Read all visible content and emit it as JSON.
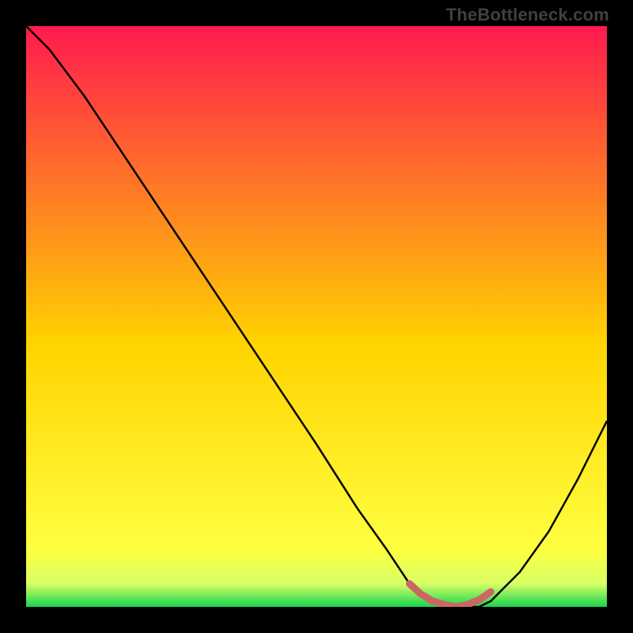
{
  "brand": "TheBottleneck.com",
  "colors": {
    "top": "#ff1a4e",
    "mid": "#ffd400",
    "low": "#ffff40",
    "bottom": "#17d64e",
    "curve": "#000000",
    "marker": "#cc6666"
  },
  "chart_data": {
    "type": "line",
    "title": "",
    "xlabel": "",
    "ylabel": "",
    "xlim": [
      0,
      100
    ],
    "ylim": [
      0,
      100
    ],
    "grid": false,
    "series": [
      {
        "name": "bottleneck-curve",
        "x": [
          0,
          4,
          10,
          20,
          30,
          40,
          50,
          57,
          62,
          66,
          70,
          74,
          78,
          80,
          85,
          90,
          95,
          100
        ],
        "y": [
          100,
          96,
          88,
          73,
          58,
          43,
          28,
          17,
          10,
          4,
          1,
          0,
          0,
          1,
          6,
          13,
          22,
          32
        ]
      }
    ],
    "highlight_marker": {
      "name": "optimal-range",
      "x": [
        66,
        68,
        70,
        72,
        74,
        76,
        78,
        80
      ],
      "y": [
        4,
        2.2,
        1,
        0.4,
        0,
        0.4,
        1.2,
        2.6
      ]
    }
  }
}
